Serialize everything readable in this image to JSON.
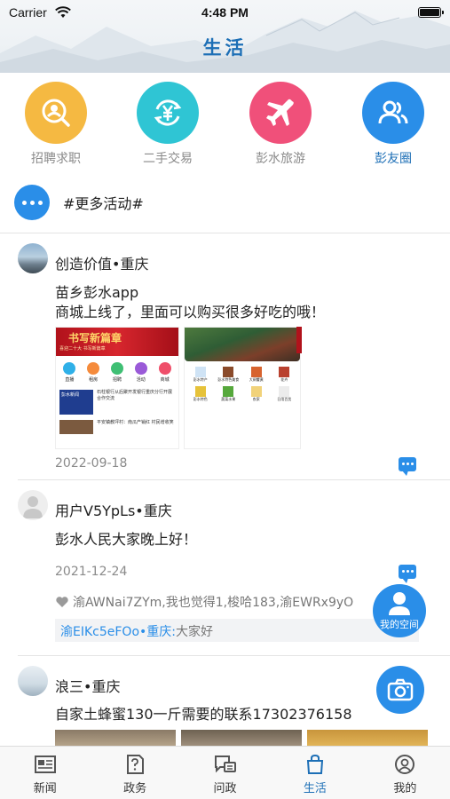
{
  "status_bar": {
    "carrier": "Carrier",
    "time": "4:48 PM"
  },
  "header": {
    "title": "生活"
  },
  "categories": [
    {
      "label": "招聘求职",
      "icon": "search-person-icon",
      "color": "#f5b942"
    },
    {
      "label": "二手交易",
      "icon": "yuan-exchange-icon",
      "color": "#2fc5d4"
    },
    {
      "label": "彭水旅游",
      "icon": "airplane-icon",
      "color": "#f0507a"
    },
    {
      "label": "彭友圈",
      "icon": "friends-icon",
      "color": "#2a8ee8"
    }
  ],
  "more_activities": {
    "label": "#更多活动#"
  },
  "posts": [
    {
      "author": "创造价值•重庆",
      "content_line1": "苗乡彭水app",
      "content_line2": "商城上线了，里面可以购买很多好吃的哦！",
      "date": "2022-09-18",
      "images": {
        "left": {
          "banner": "书写新篇章",
          "banner_sub": "喜迎二十大  书写新篇章",
          "menu": [
            "直播",
            "租房",
            "招聘",
            "活动",
            "商城"
          ],
          "news1": "石柱银行从后聚开发银行重庆分行开展合作交流",
          "news1_tag": "彭水新闻",
          "news2": "平安镇教坪村：南瓜产销红 村民增收笑"
        },
        "right": {
          "menu": [
            "彭水特产",
            "彭水特色美食",
            "大闸蟹黄",
            "花卉",
            "彭水特色",
            "蔬菜水果",
            "农家",
            "日用百货"
          ]
        }
      }
    },
    {
      "author": "用户V5YpLs•重庆",
      "content_line1": "彭水人民大家晚上好！",
      "date": "2021-12-24",
      "likes": "渝AWNai7ZYm,我也觉得1,梭哈183,渝EWRx9yO",
      "reply_user": "渝EIKc5eFOo•重庆:",
      "reply_text": "大家好"
    },
    {
      "author": "浪三•重庆",
      "content_line1": "自家土蜂蜜130一斤需要的联系17302376158"
    }
  ],
  "fab": {
    "my_space": "我的空间"
  },
  "tabbar": [
    {
      "label": "新闻",
      "icon": "newspaper-icon"
    },
    {
      "label": "政务",
      "icon": "document-question-icon"
    },
    {
      "label": "问政",
      "icon": "chat-question-icon"
    },
    {
      "label": "生活",
      "icon": "shopping-bag-icon"
    },
    {
      "label": "我的",
      "icon": "profile-icon"
    }
  ],
  "colors": {
    "accent": "#2a8ee8",
    "title": "#1d6fb6",
    "muted": "#8a8a8a"
  }
}
